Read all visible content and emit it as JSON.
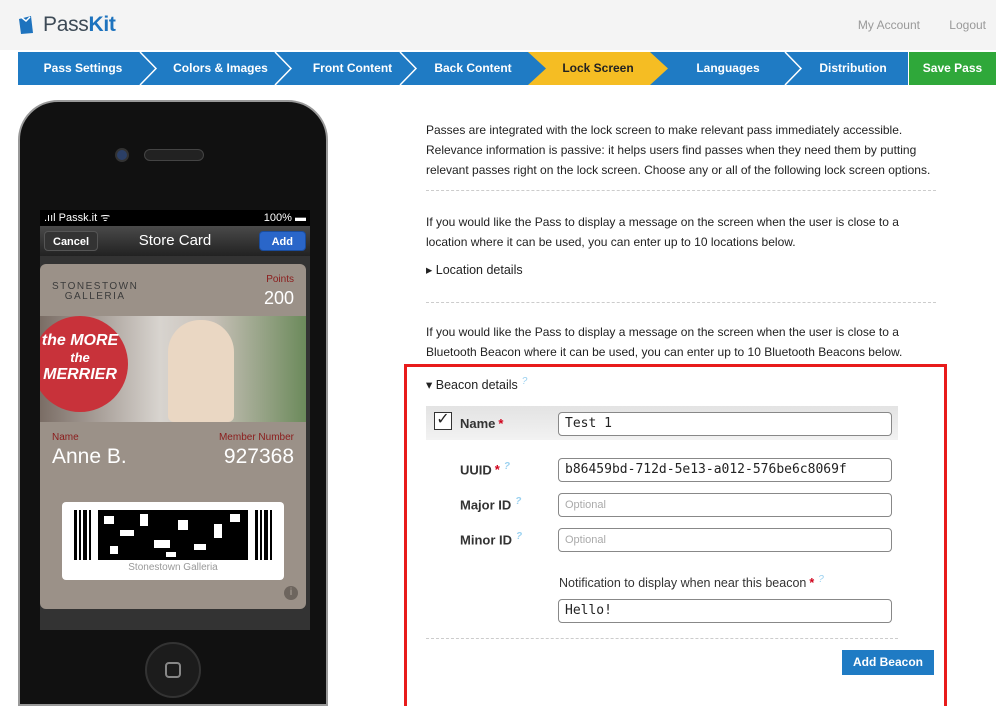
{
  "brand": {
    "prefix": "Pass",
    "suffix": "Kit"
  },
  "header": {
    "links": [
      "My Account",
      "Logout"
    ]
  },
  "wizard": {
    "steps": [
      "Pass Settings",
      "Colors & Images",
      "Front Content",
      "Back Content",
      "Lock Screen",
      "Languages",
      "Distribution"
    ],
    "active_step": "Lock Screen",
    "save_label": "Save Pass"
  },
  "phone": {
    "carrier": ".ııl Passk.it ᯤ",
    "battery": "100%",
    "nav": {
      "cancel": "Cancel",
      "title": "Store Card",
      "add": "Add"
    },
    "pass": {
      "brand_line1": "STONESTOWN",
      "brand_line2": "GALLERIA",
      "points_label": "Points",
      "points_value": "200",
      "badge_line1": "the MORE",
      "badge_line2": "the",
      "badge_line3": "MERRIER",
      "name_label": "Name",
      "name_value": "Anne B.",
      "member_label": "Member Number",
      "member_value": "927368",
      "barcode_text": "Stonestown Galleria",
      "info": "i"
    }
  },
  "content": {
    "intro": "Passes are integrated with the lock screen to make relevant pass immediately accessible. Relevance information is passive: it helps users find passes when they need them by putting relevant passes right on the lock screen. Choose any or all of the following lock screen options.",
    "location_text": "If you would like the Pass to display a message on the screen when the user is close to a location where it can be used, you can enter up to 10 locations below.",
    "location_toggle": "▸ Location details",
    "beacon_text": "If you would like the Pass to display a message on the screen when the user is close to a Bluetooth Beacon where it can be used, you can enter up to 10 Bluetooth Beacons below.",
    "beacon_toggle": "▾ Beacon details"
  },
  "beacon_form": {
    "name_label": "Name",
    "name_value": "Test 1",
    "uuid_label": "UUID",
    "uuid_value": "b86459bd-712d-5e13-a012-576be6c8069f",
    "major_label": "Major ID",
    "major_placeholder": "Optional",
    "minor_label": "Minor ID",
    "minor_placeholder": "Optional",
    "notification_label": "Notification to display when near this beacon",
    "notification_value": "Hello!",
    "required_mark": "*",
    "tip_mark": "?",
    "add_label": "Add Beacon"
  },
  "colors": {
    "nav_blue": "#1f7bc4",
    "active_step": "#f5bd23",
    "save_green": "#2fa83a",
    "highlight_red": "#e81b1b"
  }
}
